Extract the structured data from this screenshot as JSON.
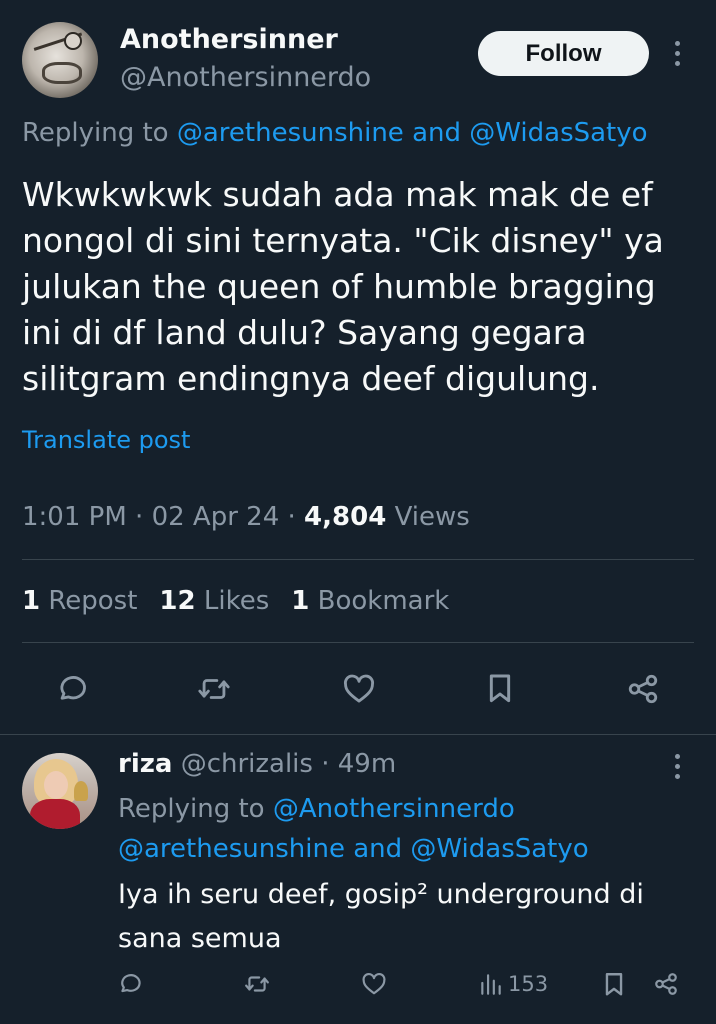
{
  "main_tweet": {
    "display_name": "Anothersinner",
    "handle": "@Anothersinnerdo",
    "follow_label": "Follow",
    "replying_prefix": "Replying to",
    "replying_user1": "@arethesunshine",
    "replying_and": "and",
    "replying_user2": "@WidasSatyo",
    "text": "Wkwkwkwk sudah ada mak mak de ef nongol di sini ternyata. \"Cik disney\" ya julukan the queen of humble bragging ini di df land dulu? Sayang gegara silitgram endingnya deef digulung.",
    "translate_label": "Translate post",
    "time": "1:01 PM",
    "date": "02 Apr 24",
    "views_count": "4,804",
    "views_label": "Views",
    "reposts_count": "1",
    "reposts_label": "Repost",
    "likes_count": "12",
    "likes_label": "Likes",
    "bookmarks_count": "1",
    "bookmarks_label": "Bookmark",
    "sep": "·"
  },
  "reply_tweet": {
    "display_name": "riza",
    "handle": "@chrizalis",
    "age": "49m",
    "sep": "·",
    "replying_prefix": "Replying to",
    "replying_user1": "@Anothersinnerdo",
    "replying_user2": "@arethesunshine",
    "replying_and": "and",
    "replying_user3": "@WidasSatyo",
    "text": "Iya ih seru deef, gosip² underground di sana semua",
    "views_count": "153"
  },
  "colors": {
    "background": "#15202b",
    "primary_text": "#f7f9f9",
    "secondary_text": "#8b98a5",
    "link": "#1d9bf0",
    "divider": "#38444d",
    "follow_bg": "#eff3f4"
  },
  "icons": [
    "reply-icon",
    "repost-icon",
    "like-icon",
    "bookmark-icon",
    "share-icon",
    "views-icon",
    "more-icon"
  ]
}
